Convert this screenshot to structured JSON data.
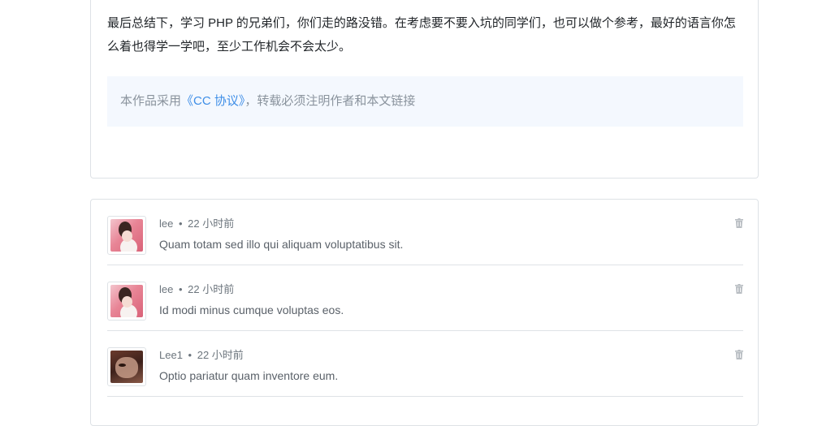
{
  "article": {
    "paragraph": "最后总结下，学习 PHP 的兄弟们，你们走的路没错。在考虑要不要入坑的同学们，也可以做个参考，最好的语言你怎么着也得学一学吧，至少工作机会不会太少。",
    "license": {
      "prefix": "本作品采用",
      "link_text": "《CC 协议》",
      "suffix": "，转载必须注明作者和本文链接"
    }
  },
  "comments": [
    {
      "author": "lee",
      "separator": "•",
      "time": "22 小时前",
      "text": "Quam totam sed illo qui aliquam voluptatibus sit.",
      "avatar_icon": "user-avatar-pink"
    },
    {
      "author": "lee",
      "separator": "•",
      "time": "22 小时前",
      "text": "Id modi minus cumque voluptas eos.",
      "avatar_icon": "user-avatar-pink"
    },
    {
      "author": "Lee1",
      "separator": "•",
      "time": "22 小时前",
      "text": "Optio pariatur quam inventore eum.",
      "avatar_icon": "user-avatar-dark"
    }
  ],
  "colors": {
    "link": "#3e8ee7",
    "license_bg": "#f4f8fe",
    "muted_text": "#6c757d",
    "border": "#dee2e6",
    "trash_icon": "#b8bdc2"
  }
}
